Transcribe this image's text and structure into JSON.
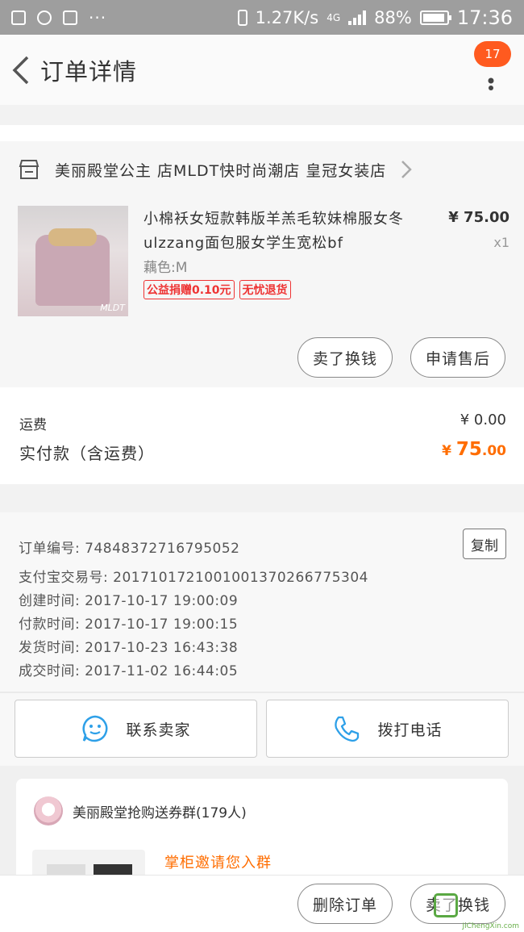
{
  "status_bar": {
    "network_speed": "1.27K/s",
    "network_type": "4G",
    "battery": "88%",
    "time": "17:36"
  },
  "header": {
    "title": "订单详情",
    "badge_count": "17"
  },
  "shop": {
    "name": "美丽殿堂公主 店MLDT快时尚潮店 皇冠女装店"
  },
  "product": {
    "title": "小棉袄女短款韩版羊羔毛软妹棉服女冬ulzzang面包服女学生宽松bf",
    "spec": "藕色:M",
    "tags": [
      "公益捐赠0.10元",
      "无忧退货"
    ],
    "price": "¥ 75.00",
    "quantity": "x1",
    "image_watermark": "MLDT",
    "actions": {
      "sell_label": "卖了换钱",
      "after_sale_label": "申请售后"
    }
  },
  "totals": {
    "shipping_label": "运费",
    "shipping_value": "¥ 0.00",
    "paid_label": "实付款（含运费）",
    "paid_currency": "¥ ",
    "paid_integer": "75",
    "paid_decimal": ".00"
  },
  "order_info": {
    "order_no": "订单编号: 74848372716795052",
    "alipay_no": "支付宝交易号: 2017101721001001370266775304",
    "created": "创建时间: 2017-10-17 19:00:09",
    "paid": "付款时间: 2017-10-17 19:00:15",
    "shipped": "发货时间: 2017-10-23 16:43:38",
    "completed": "成交时间: 2017-11-02 16:44:05",
    "copy_label": "复制"
  },
  "contact": {
    "seller_label": "联系卖家",
    "phone_label": "拨打电话"
  },
  "group": {
    "name": "美丽殿堂抢购送券群(179人)",
    "invite": "掌柜邀请您入群"
  },
  "bottom_bar": {
    "delete_label": "删除订单",
    "sell_label": "卖了换钱",
    "watermark": "JiChengXin.com"
  },
  "colors": {
    "accent_orange": "#ff6d00",
    "tag_red": "#e33333",
    "badge": "#ff5a1f"
  }
}
